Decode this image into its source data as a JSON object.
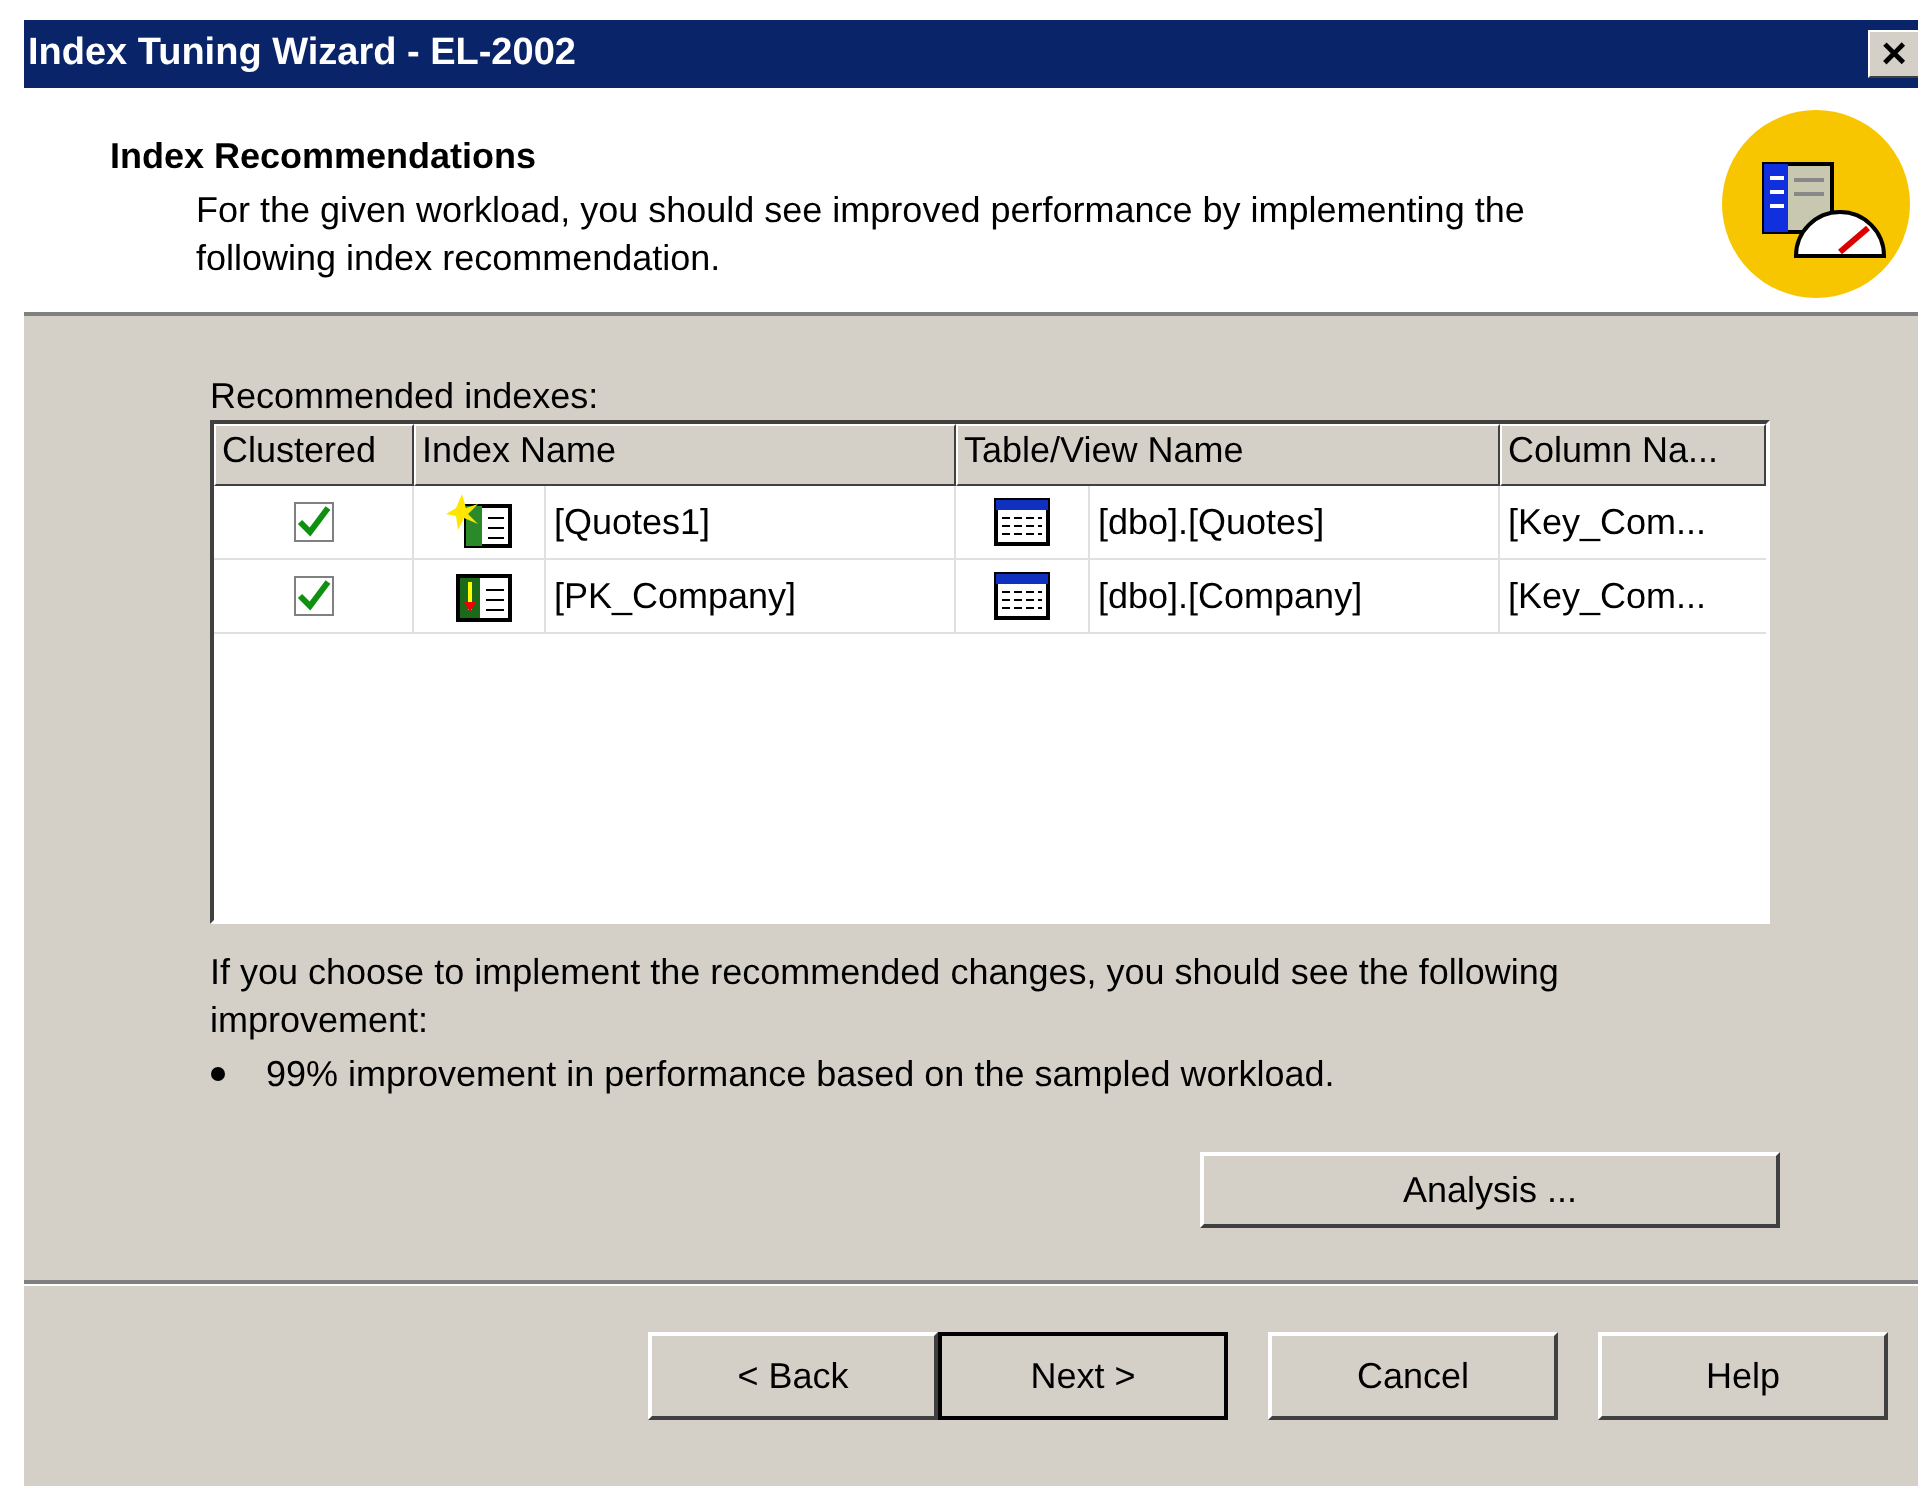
{
  "window": {
    "title": "Index Tuning Wizard - EL-2002",
    "close": "×"
  },
  "header": {
    "title": "Index Recommendations",
    "description": "For the given workload,  you should see improved performance by implementing the following index recommendation."
  },
  "list": {
    "label": "Recommended indexes:",
    "columns": [
      "Clustered",
      "Index Name",
      "Table/View Name",
      "Column Na..."
    ],
    "rows": [
      {
        "clustered": true,
        "kind": "new",
        "index_name": "[Quotes1]",
        "table_name": "[dbo].[Quotes]",
        "column_name": "[Key_Com..."
      },
      {
        "clustered": true,
        "kind": "existing",
        "index_name": "[PK_Company]",
        "table_name": "[dbo].[Company]",
        "column_name": "[Key_Com..."
      }
    ]
  },
  "improvement": {
    "intro": "If you choose to implement the recommended changes, you should see the following improvement:",
    "bullets": [
      "99% improvement in performance based on the sampled workload."
    ]
  },
  "analysis_button": "Analysis ...",
  "buttons": [
    {
      "label": "< Back",
      "default": false
    },
    {
      "label": "Next >",
      "default": true
    },
    {
      "label": "Cancel",
      "default": false
    },
    {
      "label": "Help",
      "default": false
    }
  ]
}
